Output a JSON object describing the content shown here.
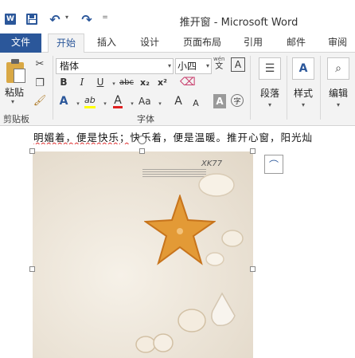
{
  "title_bar": {
    "app_logo": "W",
    "window_title": "推开窗 - Microsoft Word",
    "quick_access": {
      "save_icon": "save-icon",
      "undo_glyph": "↶",
      "redo_glyph": "↷",
      "dropdown_glyph": "▾",
      "customize_glyph": "="
    }
  },
  "tabs": {
    "file": "文件",
    "home": "开始",
    "insert": "插入",
    "design": "设计",
    "page_layout": "页面布局",
    "references": "引用",
    "mailings": "邮件",
    "review": "审阅"
  },
  "ribbon": {
    "clipboard": {
      "label": "剪贴板",
      "paste_label": "粘贴"
    },
    "font": {
      "label": "字体",
      "font_name": "楷体",
      "font_size": "小四",
      "bold": "B",
      "italic": "I",
      "underline": "U",
      "strikethrough": "abc",
      "subscript": "x₂",
      "superscript": "x²",
      "text_effects": "A",
      "highlight": "ab",
      "font_color": "A",
      "change_case": "Aa",
      "grow_font": "A",
      "shrink_font": "A",
      "char_shading": "A",
      "enclose_char": "字",
      "phonetic": "wén",
      "phonetic_char": "文",
      "char_border": "A",
      "accent_color": "#2b579a",
      "highlight_color": "#ffff00",
      "font_color_swatch": "#e02020"
    },
    "paragraph": {
      "label": "段落"
    },
    "styles": {
      "label": "样式"
    },
    "editing": {
      "label": "编辑"
    }
  },
  "document": {
    "text_part1": "明媚着，便是快乐；",
    "text_part2": "快乐着，便是温暖。推开心窗，阳光灿",
    "picture_watermark": "XK77"
  }
}
